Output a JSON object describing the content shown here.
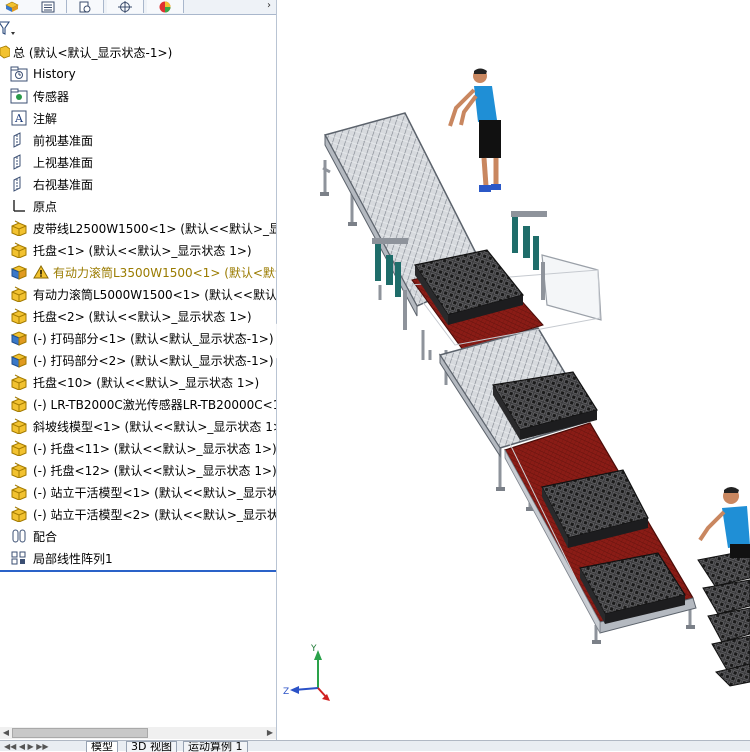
{
  "panel_tabs": [
    {
      "name": "feature-manager-tab",
      "icon": "cube-icon"
    },
    {
      "name": "property-manager-tab",
      "icon": "list-icon"
    },
    {
      "name": "configuration-manager-tab",
      "icon": "config-icon"
    },
    {
      "name": "dimxpert-tab",
      "icon": "crosshair-icon"
    },
    {
      "name": "display-manager-tab",
      "icon": "color-wheel-icon"
    }
  ],
  "tree": {
    "root_label": "总 (默认<默认_显示状态-1>)",
    "items": [
      {
        "label": "History",
        "icon": "history-folder-icon"
      },
      {
        "label": "传感器",
        "icon": "sensor-icon"
      },
      {
        "label": "注解",
        "icon": "annotation-icon"
      },
      {
        "label": "前视基准面",
        "icon": "plane-icon"
      },
      {
        "label": "上视基准面",
        "icon": "plane-icon"
      },
      {
        "label": "右视基准面",
        "icon": "plane-icon"
      },
      {
        "label": "原点",
        "icon": "origin-icon"
      },
      {
        "label": "皮带线L2500W1500<1> (默认<<默认>_显示",
        "icon": "assembly-icon"
      },
      {
        "label": "托盘<1> (默认<<默认>_显示状态 1>)",
        "icon": "assembly-icon"
      },
      {
        "label": "有动力滚筒L3500W1500<1> (默认<默认",
        "icon": "part-icon",
        "warning": true
      },
      {
        "label": "有动力滚筒L5000W1500<1> (默认<<默认>",
        "icon": "assembly-icon"
      },
      {
        "label": "托盘<2> (默认<<默认>_显示状态 1>)",
        "icon": "assembly-icon"
      },
      {
        "label": "(-) 打码部分<1> (默认<默认_显示状态-1>)",
        "icon": "part-icon"
      },
      {
        "label": "(-) 打码部分<2> (默认<默认_显示状态-1>)",
        "icon": "part-icon"
      },
      {
        "label": "托盘<10> (默认<<默认>_显示状态 1>)",
        "icon": "assembly-icon"
      },
      {
        "label": "(-) LR-TB2000C激光传感器LR-TB20000C<1",
        "icon": "assembly-icon"
      },
      {
        "label": "斜坡线模型<1> (默认<<默认>_显示状态 1>",
        "icon": "assembly-icon"
      },
      {
        "label": "(-) 托盘<11> (默认<<默认>_显示状态 1>)",
        "icon": "assembly-icon"
      },
      {
        "label": "(-) 托盘<12> (默认<<默认>_显示状态 1>)",
        "icon": "assembly-icon"
      },
      {
        "label": "(-) 站立干活模型<1> (默认<<默认>_显示状",
        "icon": "assembly-icon"
      },
      {
        "label": "(-) 站立干活模型<2> (默认<<默认>_显示状",
        "icon": "assembly-icon"
      },
      {
        "label": "配合",
        "icon": "mates-icon"
      },
      {
        "label": "局部线性阵列1",
        "icon": "pattern-icon"
      }
    ]
  },
  "bottom_tabs": [
    "模型",
    "3D 视图",
    "运动算例 1"
  ],
  "triad": {
    "y_label": "Y",
    "z_label": "Z"
  },
  "colors": {
    "roller_conveyor": "#c9ccd3",
    "belt_red": "#7a1a14",
    "tray_black": "#2a2a2a",
    "frame_grey": "#8e939b",
    "sensor_teal": "#1f6d6a",
    "shirt_blue": "#1f8fd6"
  }
}
